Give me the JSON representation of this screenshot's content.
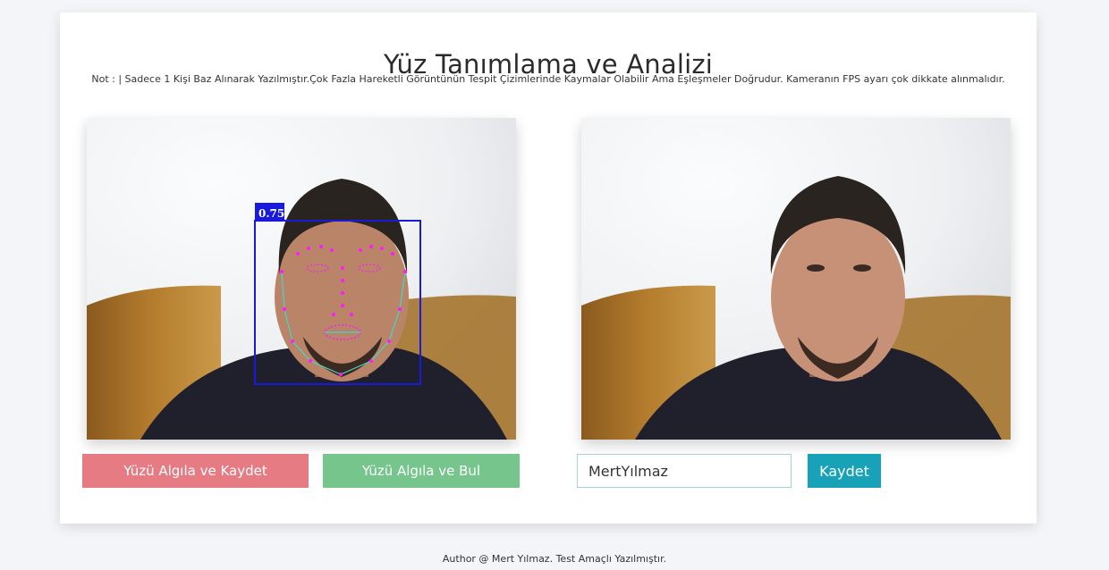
{
  "page": {
    "title": "Yüz Tanımlama ve Analizi",
    "note": "Not : | Sadece 1 Kişi Baz Alınarak Yazılmıştır.Çok Fazla Hareketli Görüntünün Tespit Çizimlerinde Kaymalar Olabilir Ama Eşleşmeler Doğrudur. Kameranın FPS ayarı çok dikkate alınmalıdır."
  },
  "left_camera": {
    "detection_score": "0.75",
    "box_color": "#1a1adc",
    "landmark_color": "#ff1aff",
    "contour_color": "#40d8c8"
  },
  "buttons": {
    "detect_save": "Yüzü Algıla ve Kaydet",
    "detect_find": "Yüzü Algıla ve Bul",
    "save": "Kaydet"
  },
  "name_input": {
    "value": "MertYılmaz"
  },
  "colors": {
    "red_button": "#e77b84",
    "green_button": "#75c58c",
    "teal_button": "#17a2b8"
  },
  "footer": "Author @ Mert Yılmaz. Test Amaçlı Yazılmıştır."
}
